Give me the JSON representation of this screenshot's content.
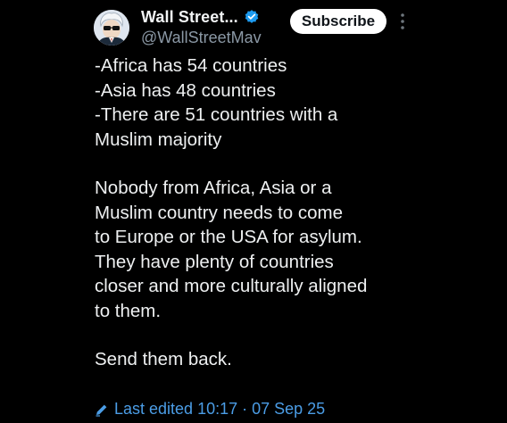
{
  "author": {
    "display_name": "Wall Street...",
    "handle": "@WallStreetMav",
    "verified": true
  },
  "actions": {
    "subscribe_label": "Subscribe",
    "more_icon": "more-vertical-icon"
  },
  "post": {
    "lines": [
      "-Africa has 54 countries",
      "-Asia has 48 countries",
      "-There are 51 countries with a",
      "Muslim majority",
      "",
      "Nobody from Africa, Asia or a",
      "Muslim country needs to come",
      "to Europe or the USA for asylum.",
      "They have plenty of countries",
      "closer and more culturally aligned",
      "to them.",
      "",
      "Send them back."
    ]
  },
  "meta": {
    "edited_label": "Last edited 10:17 · 07 Sep 25"
  },
  "colors": {
    "background": "#000000",
    "text": "#e7e9ea",
    "secondary": "#8b98a5",
    "link": "#4b9de6",
    "verified": "#1d9bf0"
  }
}
